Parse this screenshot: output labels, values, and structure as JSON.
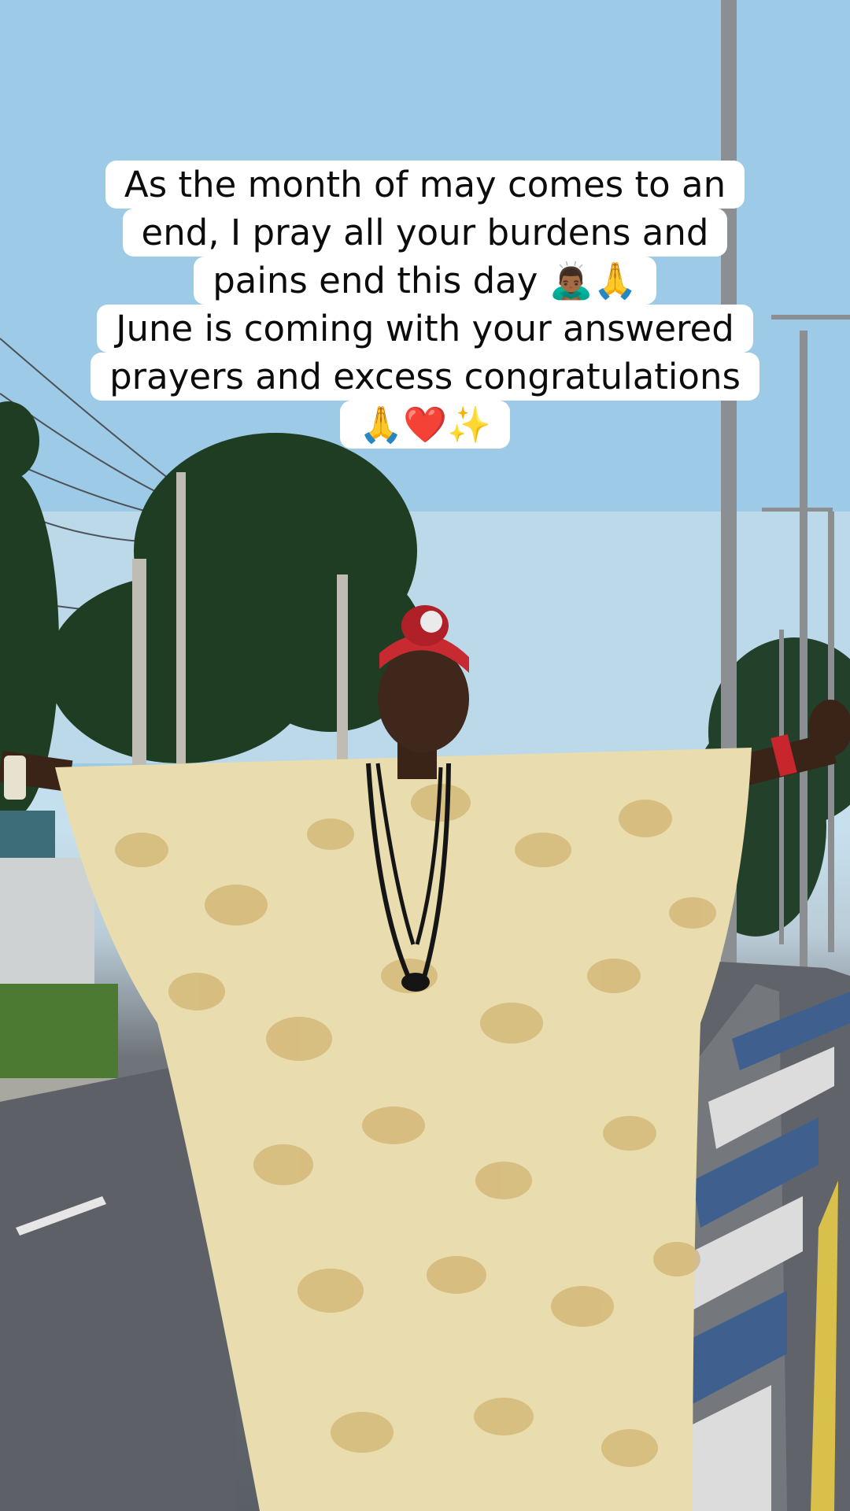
{
  "caption": {
    "lines": [
      "As the month of may comes to an",
      "end, I pray all your burdens and",
      "pains end this day 🙇🏾‍♂️🙏",
      "June is coming with your answered",
      "prayers and excess congratulations",
      "🙏❤️✨"
    ]
  },
  "scene": {
    "description_icons": [
      "streetlight-icon",
      "tree-icon",
      "person-icon",
      "road-icon"
    ]
  },
  "colors": {
    "sky": "#9ccbe6",
    "robe": "#e9dcae",
    "robe_pattern": "#c9a55c",
    "road": "#5d6167",
    "curb_blue": "#3f5f8f",
    "caption_bg": "#ffffff",
    "caption_text": "#0c0c0c"
  }
}
